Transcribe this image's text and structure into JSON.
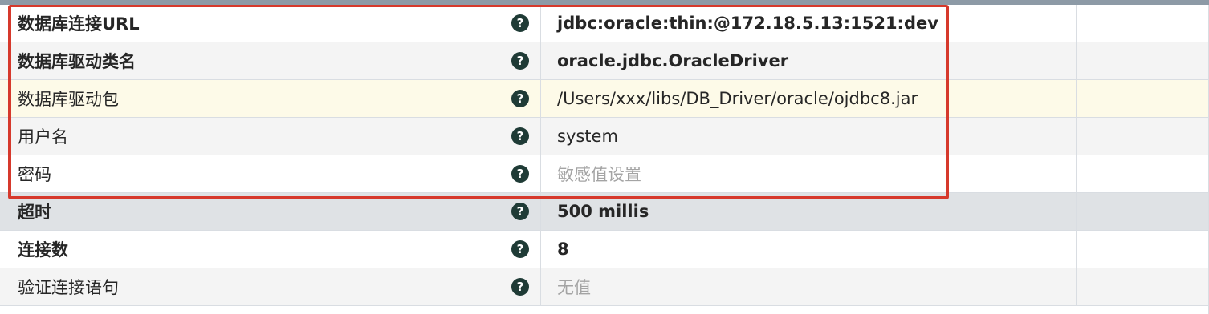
{
  "properties": [
    {
      "name": "数据库连接URL",
      "value": "jdbc:oracle:thin:@172.18.5.13:1521:dev",
      "help": "?"
    },
    {
      "name": "数据库驱动类名",
      "value": "oracle.jdbc.OracleDriver",
      "help": "?"
    },
    {
      "name": "数据库驱动包",
      "value": "/Users/xxx/libs/DB_Driver/oracle/ojdbc8.jar",
      "help": "?"
    },
    {
      "name": "用户名",
      "value": "system",
      "help": "?"
    },
    {
      "name": "密码",
      "value": "敏感值设置",
      "help": "?"
    },
    {
      "name": "超时",
      "value": "500 millis",
      "help": "?"
    },
    {
      "name": "连接数",
      "value": "8",
      "help": "?"
    },
    {
      "name": "验证连接语句",
      "value": "无值",
      "help": "?"
    }
  ],
  "colors": {
    "highlight_frame": "#d6392c",
    "help_icon": "#1f3b36",
    "highlight_row": "#fdfae8",
    "section_row": "#dfe2e5",
    "placeholder_text": "#a4a4a4"
  }
}
